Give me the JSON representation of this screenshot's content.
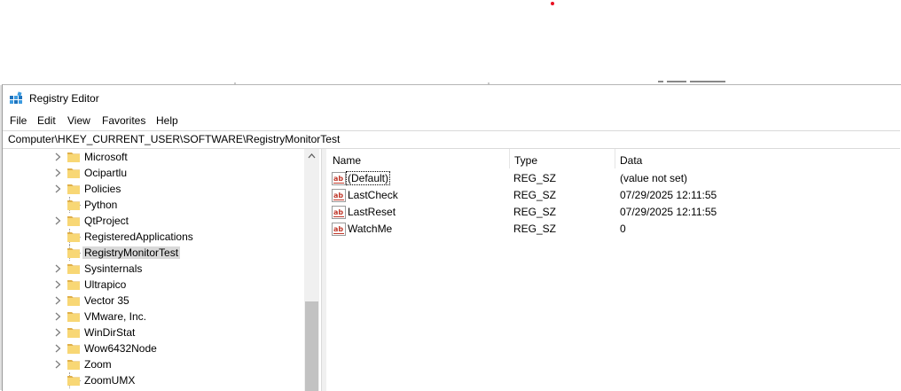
{
  "window": {
    "title": "Registry Editor"
  },
  "menu": [
    "File",
    "Edit",
    "View",
    "Favorites",
    "Help"
  ],
  "address": "Computer\\HKEY_CURRENT_USER\\SOFTWARE\\RegistryMonitorTest",
  "tree": {
    "items": [
      {
        "label": "Microsoft",
        "expandable": true
      },
      {
        "label": "Ocipartlu",
        "expandable": true
      },
      {
        "label": "Policies",
        "expandable": true
      },
      {
        "label": "Python",
        "expandable": false
      },
      {
        "label": "QtProject",
        "expandable": true
      },
      {
        "label": "RegisteredApplications",
        "expandable": false
      },
      {
        "label": "RegistryMonitorTest",
        "expandable": false,
        "selected": true
      },
      {
        "label": "Sysinternals",
        "expandable": true
      },
      {
        "label": "Ultrapico",
        "expandable": true
      },
      {
        "label": "Vector 35",
        "expandable": true
      },
      {
        "label": "VMware, Inc.",
        "expandable": true
      },
      {
        "label": "WinDirStat",
        "expandable": true
      },
      {
        "label": "Wow6432Node",
        "expandable": true
      },
      {
        "label": "Zoom",
        "expandable": true
      },
      {
        "label": "ZoomUMX",
        "expandable": false
      }
    ]
  },
  "columns": {
    "name": "Name",
    "type": "Type",
    "data": "Data"
  },
  "values": [
    {
      "name": "(Default)",
      "type": "REG_SZ",
      "data": "(value not set)"
    },
    {
      "name": "LastCheck",
      "type": "REG_SZ",
      "data": "07/29/2025 12:11:55"
    },
    {
      "name": "LastReset",
      "type": "REG_SZ",
      "data": "07/29/2025 12:11:55"
    },
    {
      "name": "WatchMe",
      "type": "REG_SZ",
      "data": "0"
    }
  ],
  "colors": {
    "folder": "#f8d775",
    "folder_dark": "#e0b04a",
    "selection": "#d9d9d9",
    "accent_red": "#e81123"
  }
}
